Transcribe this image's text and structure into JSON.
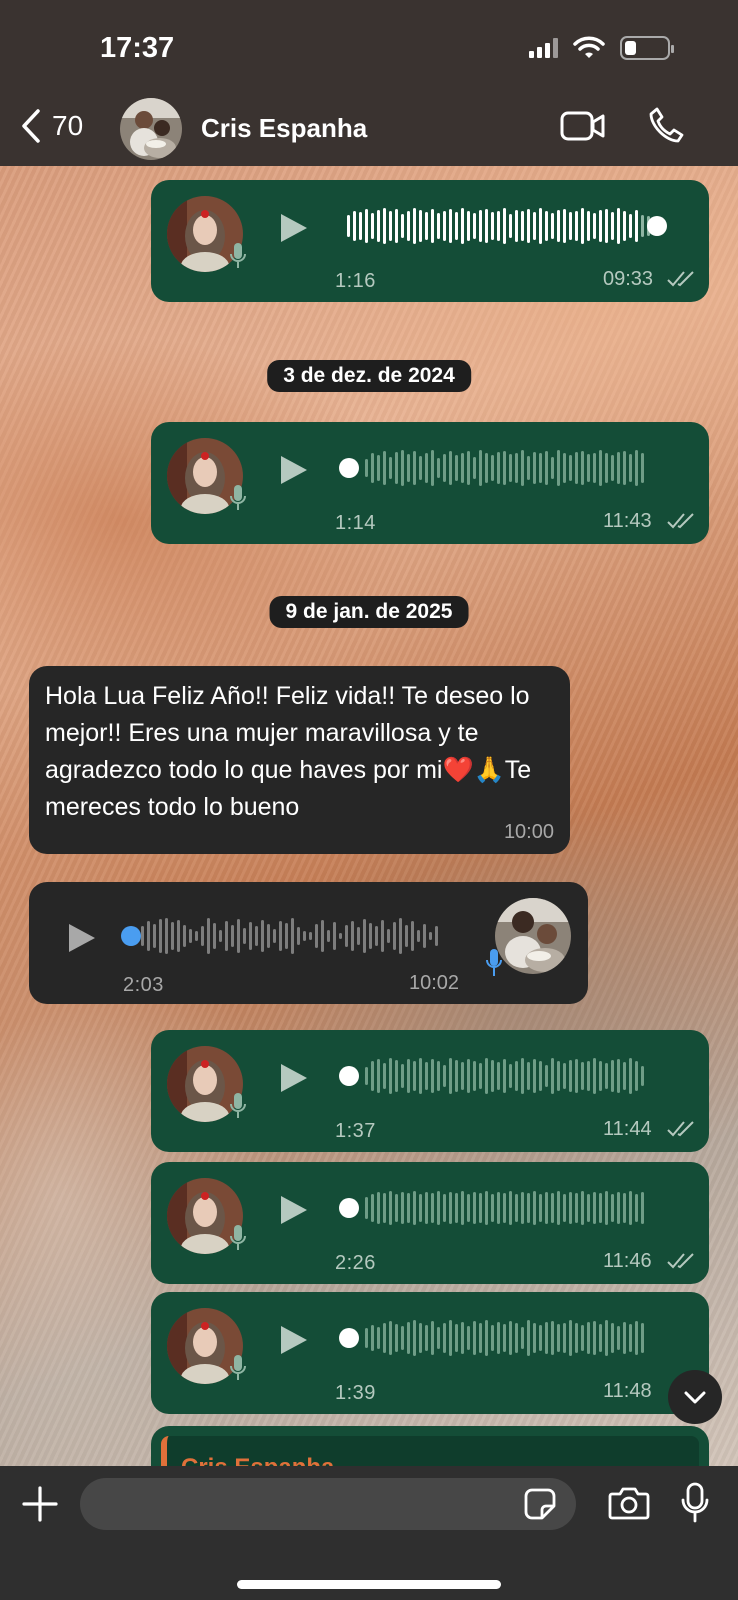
{
  "status": {
    "time": "17:37"
  },
  "header": {
    "back_count": "70",
    "contact_name": "Cris Espanha"
  },
  "dates": [
    "3 de dez. de 2024",
    "9 de jan. de 2025"
  ],
  "messages": {
    "out_voice": [
      {
        "duration": "1:16",
        "time": "09:33",
        "played": true
      },
      {
        "duration": "1:14",
        "time": "11:43",
        "played": false
      },
      {
        "duration": "1:37",
        "time": "11:44",
        "played": false
      },
      {
        "duration": "2:26",
        "time": "11:46",
        "played": false
      },
      {
        "duration": "1:39",
        "time": "11:48",
        "played": false
      }
    ],
    "in_text": {
      "text": "Hola Lua Feliz Año!! Feliz vida!! Te deseo lo mejor!! Eres una mujer maravillosa y te agradezco todo lo que haves por mi❤️🙏Te mereces todo lo bueno",
      "time": "10:00"
    },
    "in_voice": {
      "duration": "2:03",
      "time": "10:02"
    },
    "reply_preview_name": "Cris Espanha"
  },
  "composer": {
    "placeholder": ""
  },
  "colors": {
    "outgoing_bubble": "#144d37",
    "incoming_bubble": "#262626",
    "accent_blue": "#4a9df0",
    "reply_accent": "#e0703a"
  }
}
